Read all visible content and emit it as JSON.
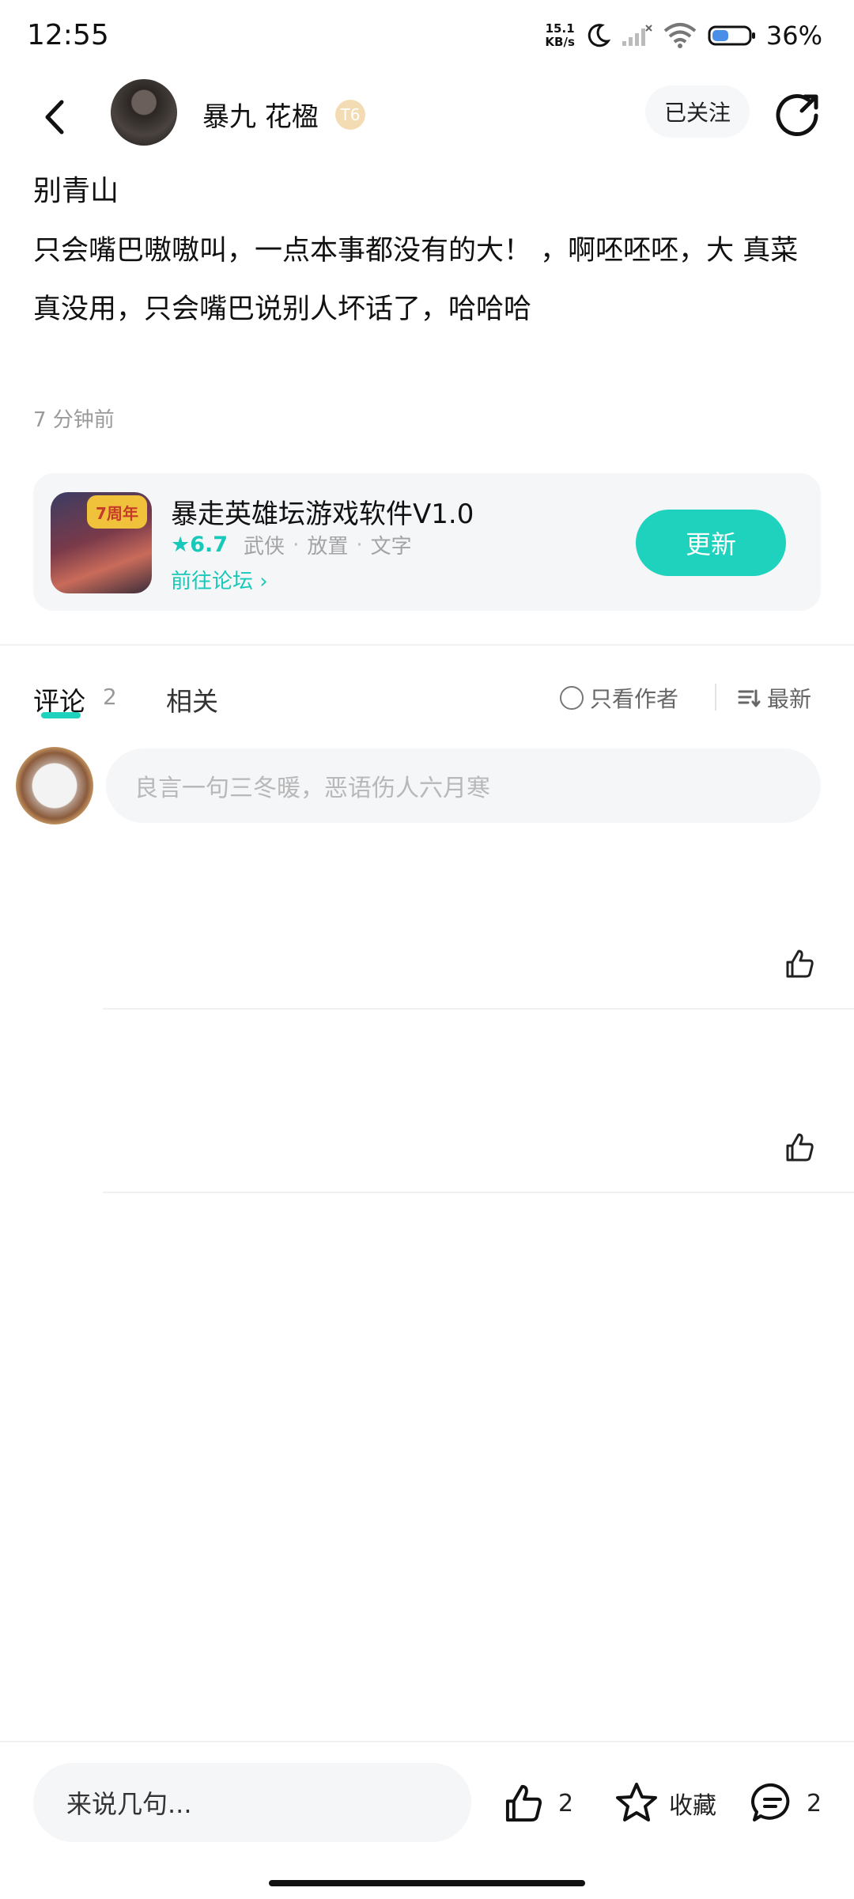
{
  "status_bar": {
    "time": "12:55",
    "network_speed_value": "15.1",
    "network_speed_unit": "KB/s",
    "battery": "36%"
  },
  "header": {
    "author_name": "暴九 花楹",
    "level_badge": "T6",
    "follow_label": "已关注",
    "icons": [
      "back-icon",
      "share-icon"
    ]
  },
  "post": {
    "title": "别青山",
    "body": "只会嘴巴嗷嗷叫，一点本事都没有的大！ ，啊呸呸呸，大 真菜真没用，只会嘴巴说别人坏话了，哈哈哈",
    "time": "7 分钟前"
  },
  "game_card": {
    "icon_badge": "7周年",
    "name": "暴走英雄坛游戏软件V1.0",
    "rating": "★6.7",
    "tags": [
      "武侠",
      "放置",
      "文字"
    ],
    "link": "前往论坛 ›",
    "update_label": "更新",
    "colors": {
      "accent": "#1fd2be"
    }
  },
  "tabs": {
    "comments_label": "评论",
    "comments_count": "2",
    "related_label": "相关",
    "author_only_label": "只看作者",
    "sort_label": "最新"
  },
  "comment_input": {
    "placeholder": "良言一句三冬暖，恶语伤人六月寒"
  },
  "bottom_bar": {
    "input_placeholder": "来说几句...",
    "like_count": "2",
    "collect_label": "收藏",
    "comment_count": "2"
  }
}
